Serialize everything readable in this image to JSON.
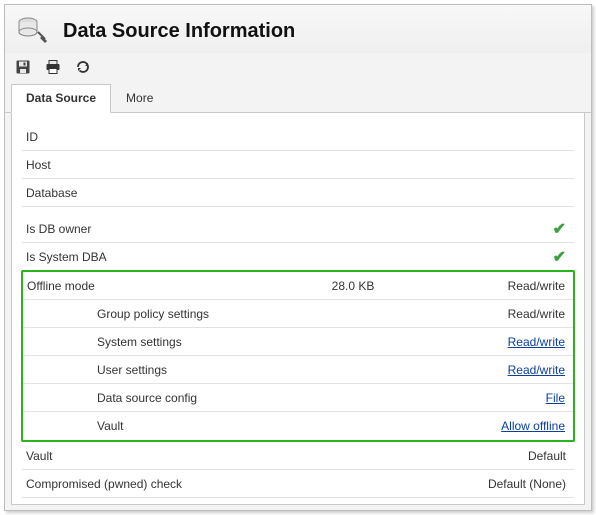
{
  "header": {
    "title": "Data Source Information"
  },
  "toolbar": {
    "save_icon": "save-icon",
    "print_icon": "print-icon",
    "refresh_icon": "refresh-icon"
  },
  "tabs": {
    "data_source": "Data Source",
    "more": "More"
  },
  "rows": {
    "id_label": "ID",
    "id_value": "",
    "host_label": "Host",
    "host_value": "",
    "database_label": "Database",
    "database_value": "",
    "db_owner_label": "Is DB owner",
    "system_dba_label": "Is System DBA",
    "offline_mode_label": "Offline mode",
    "offline_mode_size": "28.0 KB",
    "offline_mode_value": "Read/write",
    "group_policy_label": "Group policy settings",
    "group_policy_value": "Read/write",
    "system_settings_label": "System settings",
    "system_settings_value": "Read/write",
    "user_settings_label": "User settings",
    "user_settings_value": "Read/write",
    "data_source_config_label": "Data source config",
    "data_source_config_value": "File",
    "vault_sub_label": "Vault",
    "vault_sub_value": "Allow offline",
    "vault_label": "Vault",
    "vault_value": "Default",
    "pwned_label": "Compromised (pwned) check",
    "pwned_value": "Default (None)"
  }
}
